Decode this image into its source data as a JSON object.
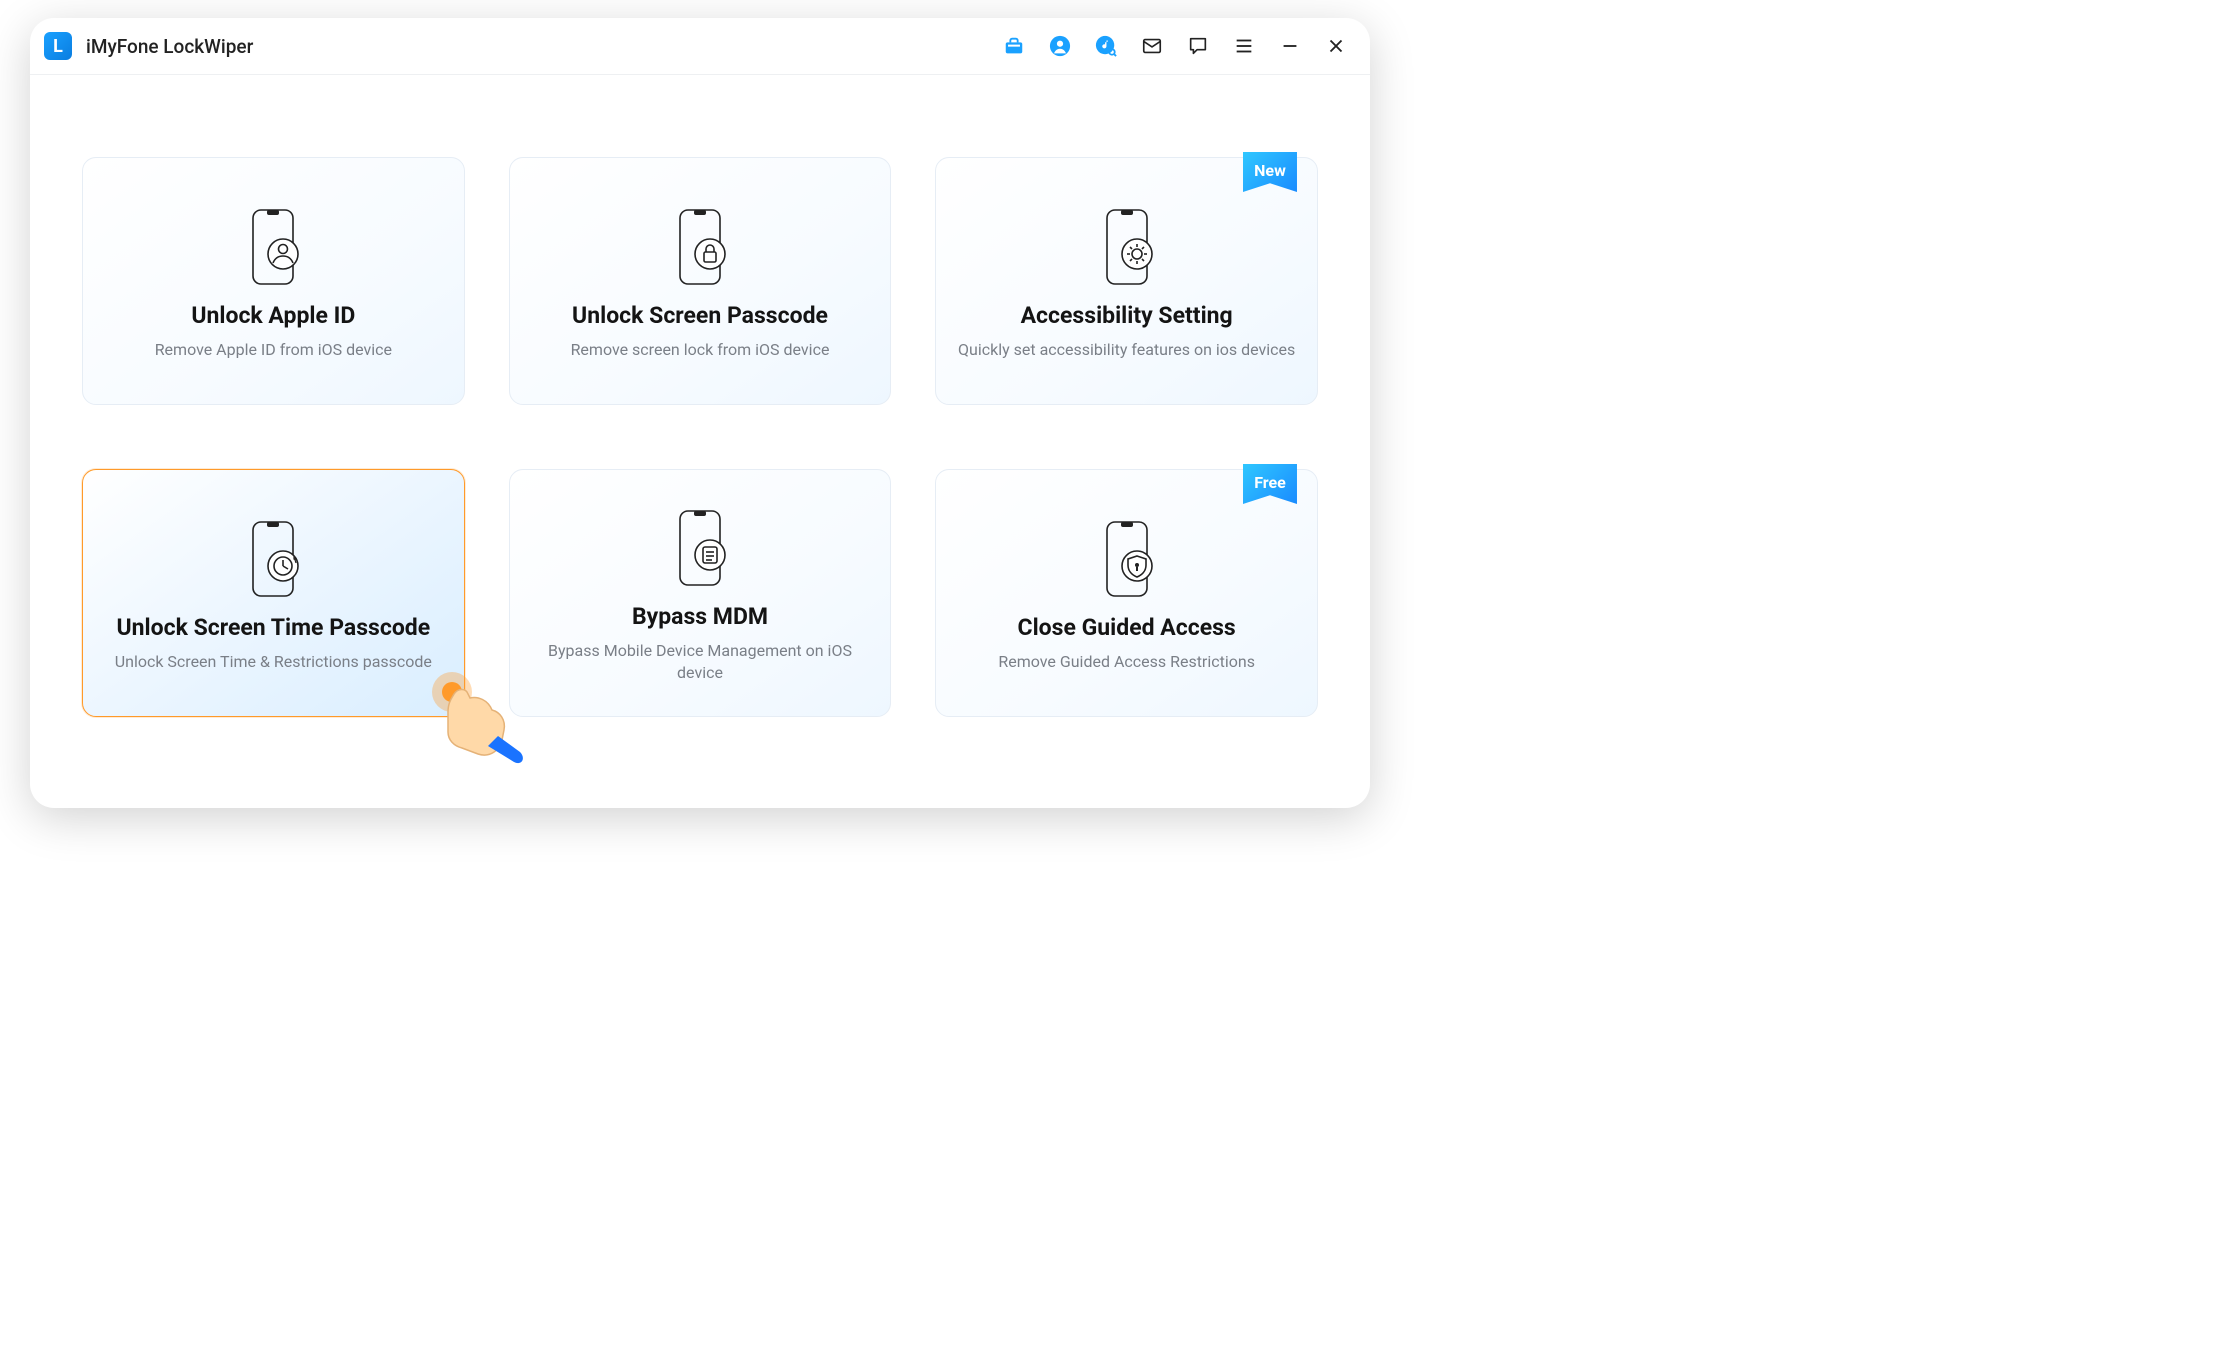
{
  "app": {
    "title": "iMyFone LockWiper",
    "logoLetter": "L"
  },
  "cards": [
    {
      "title": "Unlock Apple ID",
      "desc": "Remove Apple ID from iOS device",
      "ribbon": null
    },
    {
      "title": "Unlock Screen Passcode",
      "desc": "Remove screen lock from iOS device",
      "ribbon": null
    },
    {
      "title": "Accessibility Setting",
      "desc": "Quickly set accessibility features on ios devices",
      "ribbon": "New"
    },
    {
      "title": "Unlock Screen Time Passcode",
      "desc": "Unlock Screen Time & Restrictions passcode",
      "ribbon": null
    },
    {
      "title": "Bypass MDM",
      "desc": "Bypass Mobile Device Management on iOS device",
      "ribbon": null
    },
    {
      "title": "Close Guided Access",
      "desc": "Remove Guided Access Restrictions",
      "ribbon": "Free"
    }
  ]
}
